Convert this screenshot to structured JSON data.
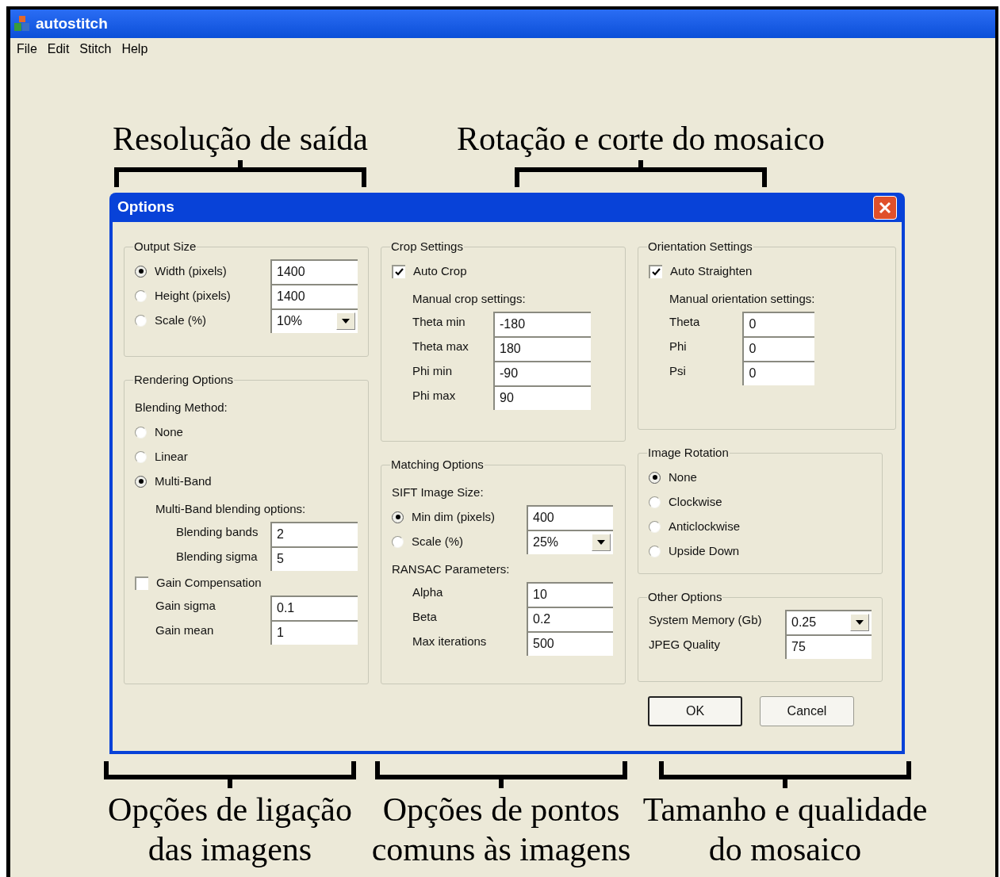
{
  "app": {
    "title": "autostitch",
    "menu": [
      "File",
      "Edit",
      "Stitch",
      "Help"
    ]
  },
  "annotations_top": [
    "Resolução de saída",
    "Rotação e corte do mosaico"
  ],
  "annotations_bottom": [
    "Opções de ligação\ndas imagens",
    "Opções de pontos\ncomuns às imagens",
    "Tamanho e qualidade\ndo mosaico"
  ],
  "dialog": {
    "title": "Options",
    "columns": [
      [
        {
          "title": "Output Size",
          "rows": [
            {
              "kind": "radio",
              "label": "Width (pixels)",
              "selected": true,
              "field": {
                "kind": "text",
                "value": "1400"
              }
            },
            {
              "kind": "radio",
              "label": "Height (pixels)",
              "selected": false,
              "field": {
                "kind": "text",
                "value": "1400"
              }
            },
            {
              "kind": "radio",
              "label": "Scale (%)",
              "selected": false,
              "field": {
                "kind": "combo",
                "value": "10%"
              }
            }
          ]
        },
        {
          "title": "Rendering Options",
          "rows": [
            {
              "kind": "note",
              "text": "Blending Method:"
            },
            {
              "kind": "radio",
              "label": "None",
              "selected": false
            },
            {
              "kind": "radio",
              "label": "Linear",
              "selected": false
            },
            {
              "kind": "radio",
              "label": "Multi-Band",
              "selected": true
            },
            {
              "kind": "subgroup",
              "children": [
                {
                  "kind": "note",
                  "text": "Multi-Band blending options:"
                },
                {
                  "kind": "subgroup",
                  "children": [
                    {
                      "kind": "input",
                      "label": "Blending bands",
                      "field": {
                        "kind": "text",
                        "value": "2"
                      }
                    },
                    {
                      "kind": "input",
                      "label": "Blending sigma",
                      "field": {
                        "kind": "text",
                        "value": "5"
                      }
                    }
                  ]
                }
              ]
            },
            {
              "kind": "checkbox",
              "label": "Gain Compensation",
              "checked": false
            },
            {
              "kind": "subgroup",
              "children": [
                {
                  "kind": "input",
                  "label": "Gain sigma",
                  "field": {
                    "kind": "text",
                    "value": "0.1"
                  }
                },
                {
                  "kind": "input",
                  "label": "Gain mean",
                  "field": {
                    "kind": "text",
                    "value": "1"
                  }
                }
              ]
            }
          ]
        }
      ],
      [
        {
          "title": "Crop Settings",
          "rows": [
            {
              "kind": "checkbox",
              "label": "Auto Crop",
              "checked": true
            },
            {
              "kind": "subgroup",
              "children": [
                {
                  "kind": "note",
                  "text": "Manual crop settings:"
                },
                {
                  "kind": "input",
                  "label": "Theta min",
                  "field": {
                    "kind": "text",
                    "value": "-180"
                  }
                },
                {
                  "kind": "input",
                  "label": "Theta max",
                  "field": {
                    "kind": "text",
                    "value": "180"
                  }
                },
                {
                  "kind": "input",
                  "label": "Phi min",
                  "field": {
                    "kind": "text",
                    "value": "-90"
                  }
                },
                {
                  "kind": "input",
                  "label": "Phi max",
                  "field": {
                    "kind": "text",
                    "value": "90"
                  }
                }
              ]
            }
          ]
        },
        {
          "title": "Matching Options",
          "rows": [
            {
              "kind": "note",
              "text": "SIFT Image Size:"
            },
            {
              "kind": "radio",
              "label": "Min dim (pixels)",
              "selected": true,
              "field": {
                "kind": "text",
                "value": "400"
              }
            },
            {
              "kind": "radio",
              "label": "Scale (%)",
              "selected": false,
              "field": {
                "kind": "combo",
                "value": "25%"
              }
            },
            {
              "kind": "note",
              "text": "RANSAC Parameters:"
            },
            {
              "kind": "subgroup",
              "children": [
                {
                  "kind": "input",
                  "label": "Alpha",
                  "field": {
                    "kind": "text",
                    "value": "10"
                  }
                },
                {
                  "kind": "input",
                  "label": "Beta",
                  "field": {
                    "kind": "text",
                    "value": "0.2"
                  }
                },
                {
                  "kind": "input",
                  "label": "Max iterations",
                  "field": {
                    "kind": "text",
                    "value": "500"
                  }
                }
              ]
            }
          ]
        }
      ],
      [
        {
          "title": "Orientation Settings",
          "rows": [
            {
              "kind": "checkbox",
              "label": "Auto Straighten",
              "checked": true
            },
            {
              "kind": "subgroup",
              "children": [
                {
                  "kind": "note",
                  "text": "Manual orientation settings:"
                },
                {
                  "kind": "input",
                  "label": "Theta",
                  "field": {
                    "kind": "text",
                    "value": "0"
                  }
                },
                {
                  "kind": "input",
                  "label": "Phi",
                  "field": {
                    "kind": "text",
                    "value": "0"
                  }
                },
                {
                  "kind": "input",
                  "label": "Psi",
                  "field": {
                    "kind": "text",
                    "value": "0"
                  }
                }
              ]
            }
          ]
        },
        {
          "title": "Image Rotation",
          "rows": [
            {
              "kind": "radio",
              "label": "None",
              "selected": true
            },
            {
              "kind": "radio",
              "label": "Clockwise",
              "selected": false
            },
            {
              "kind": "radio",
              "label": "Anticlockwise",
              "selected": false
            },
            {
              "kind": "radio",
              "label": "Upside Down",
              "selected": false
            }
          ]
        },
        {
          "title": "Other Options",
          "rows": [
            {
              "kind": "input",
              "label": "System Memory (Gb)",
              "field": {
                "kind": "combo",
                "value": "0.25"
              }
            },
            {
              "kind": "input",
              "label": "JPEG Quality",
              "field": {
                "kind": "text",
                "value": "75"
              }
            }
          ]
        }
      ]
    ],
    "buttons": [
      {
        "label": "OK",
        "default": true
      },
      {
        "label": "Cancel",
        "default": false
      }
    ]
  }
}
